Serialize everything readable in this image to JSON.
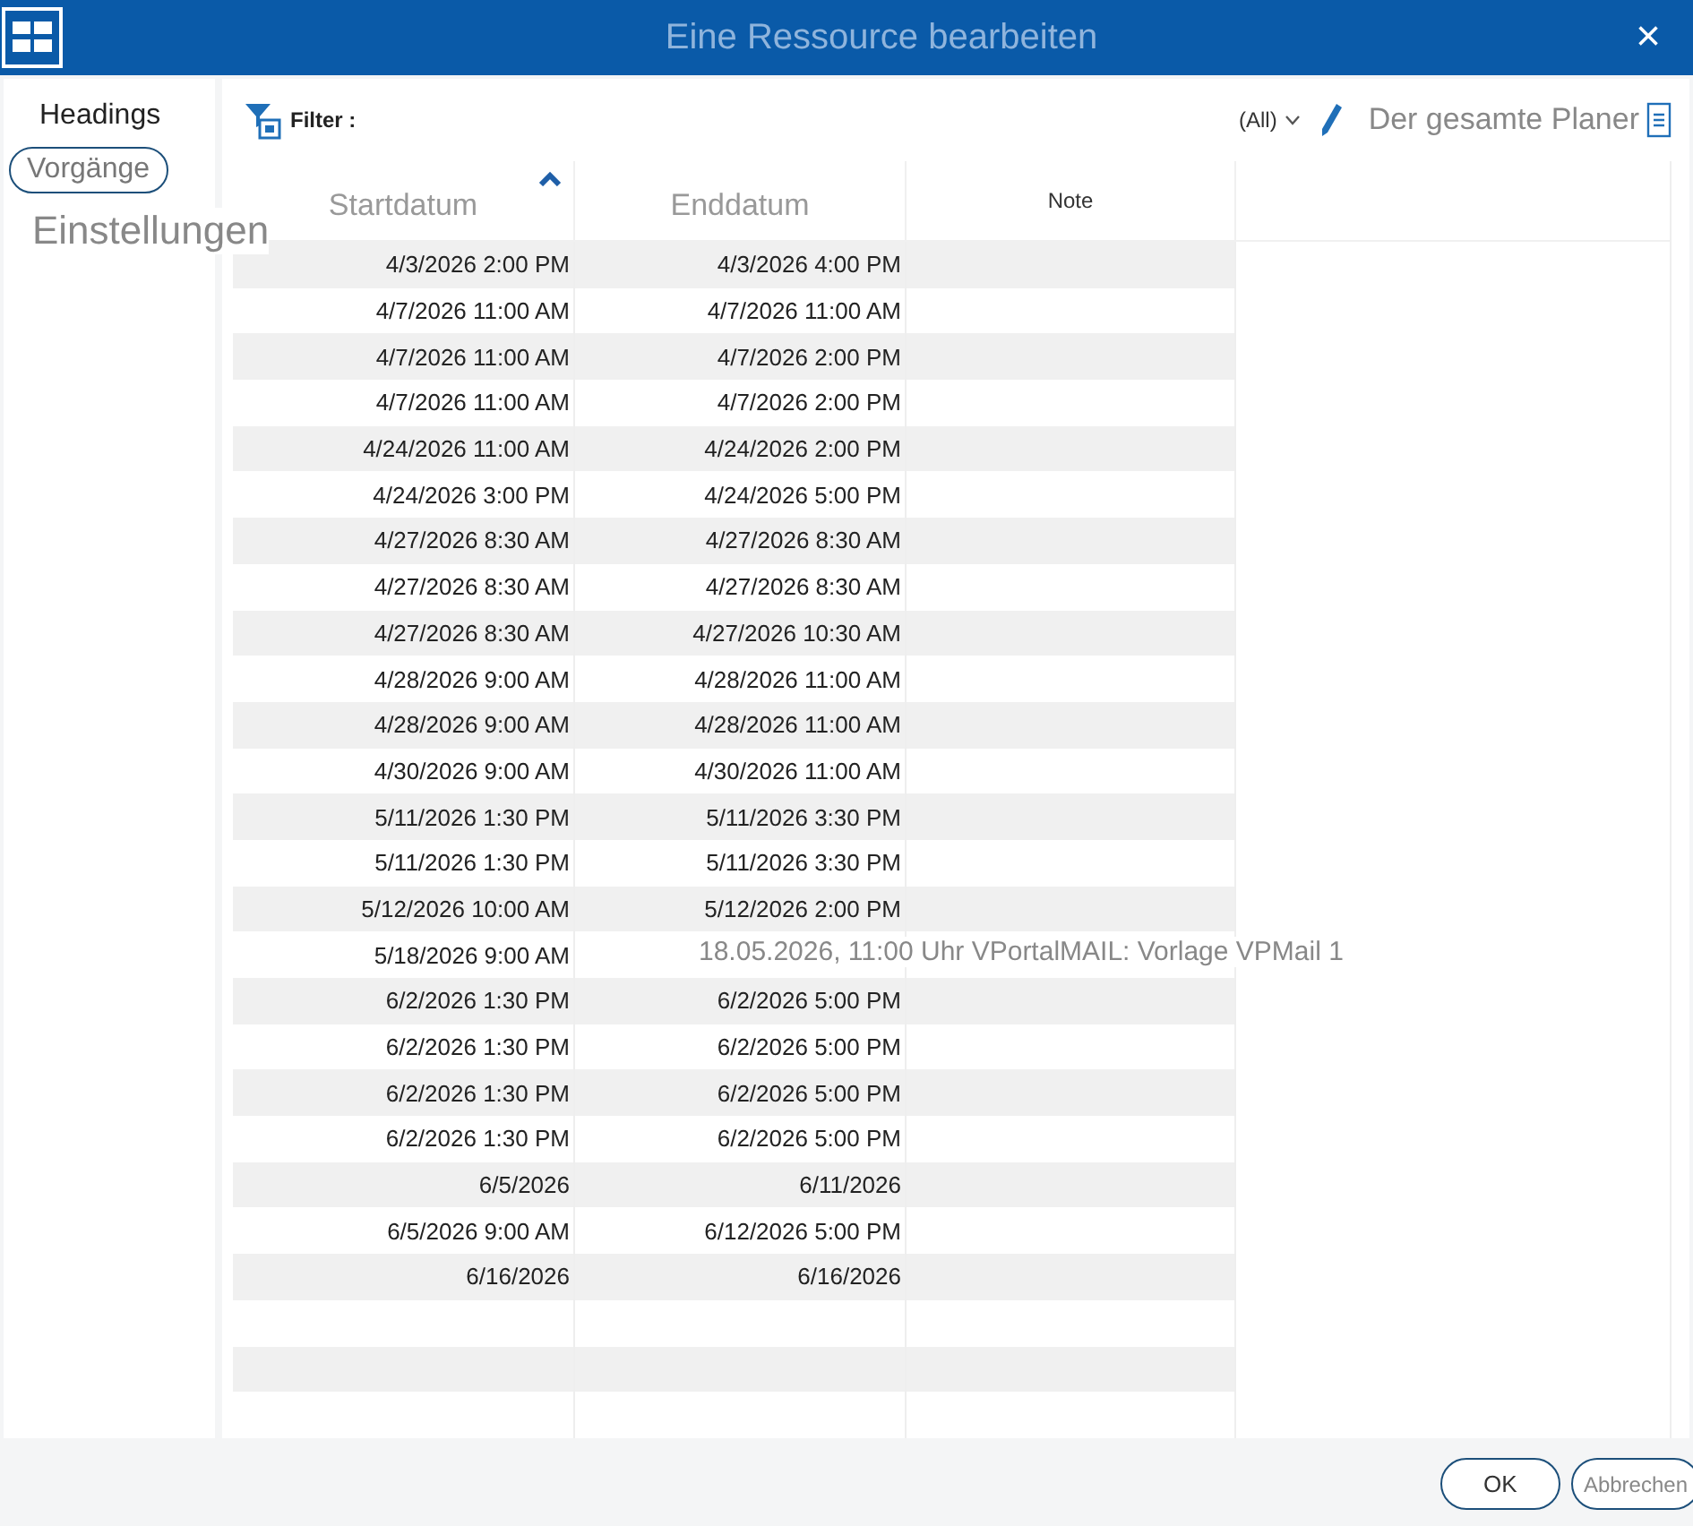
{
  "window": {
    "title": "Eine Ressource bearbeiten",
    "close": "×"
  },
  "sidebar": {
    "heading": "Headings",
    "items": [
      {
        "label": "Vorgänge",
        "selected": true
      },
      {
        "label": "Einstellungen",
        "selected": false
      }
    ]
  },
  "toolbar": {
    "filter_label": "Filter :",
    "scope": "(All)",
    "view": "Der gesamte Planer"
  },
  "table": {
    "columns": [
      {
        "label": "Startdatum",
        "sorted": true
      },
      {
        "label": "Enddatum",
        "sorted": false
      },
      {
        "label": "Note",
        "sorted": false
      }
    ],
    "rows": [
      {
        "start": "4/3/2026 2:00 PM",
        "end": "4/3/2026 4:00 PM"
      },
      {
        "start": "4/7/2026 11:00 AM",
        "end": "4/7/2026 11:00 AM"
      },
      {
        "start": "4/7/2026 11:00 AM",
        "end": "4/7/2026 2:00 PM"
      },
      {
        "start": "4/7/2026 11:00 AM",
        "end": "4/7/2026 2:00 PM"
      },
      {
        "start": "4/24/2026 11:00 AM",
        "end": "4/24/2026 2:00 PM"
      },
      {
        "start": "4/24/2026 3:00 PM",
        "end": "4/24/2026 5:00 PM"
      },
      {
        "start": "4/27/2026 8:30 AM",
        "end": "4/27/2026 8:30 AM"
      },
      {
        "start": "4/27/2026 8:30 AM",
        "end": "4/27/2026 8:30 AM"
      },
      {
        "start": "4/27/2026 8:30 AM",
        "end": "4/27/2026 10:30 AM"
      },
      {
        "start": "4/28/2026 9:00 AM",
        "end": "4/28/2026 11:00 AM"
      },
      {
        "start": "4/28/2026 9:00 AM",
        "end": "4/28/2026 11:00 AM"
      },
      {
        "start": "4/30/2026 9:00 AM",
        "end": "4/30/2026 11:00 AM"
      },
      {
        "start": "5/11/2026 1:30 PM",
        "end": "5/11/2026 3:30 PM"
      },
      {
        "start": "5/11/2026 1:30 PM",
        "end": "5/11/2026 3:30 PM"
      },
      {
        "start": "5/12/2026 10:00 AM",
        "end": "5/12/2026 2:00 PM"
      },
      {
        "start": "5/18/2026 9:00 AM",
        "tooltip": "18.05.2026, 11:00 Uhr VPortalMAIL: Vorlage VPMail 1"
      },
      {
        "start": "6/2/2026 1:30 PM",
        "end": "6/2/2026 5:00 PM"
      },
      {
        "start": "6/2/2026 1:30 PM",
        "end": "6/2/2026 5:00 PM"
      },
      {
        "start": "6/2/2026 1:30 PM",
        "end": "6/2/2026 5:00 PM"
      },
      {
        "start": "6/2/2026 1:30 PM",
        "end": "6/2/2026 5:00 PM"
      },
      {
        "start": "6/5/2026",
        "end": "6/11/2026"
      },
      {
        "start": "6/5/2026 9:00 AM",
        "end": "6/12/2026 5:00 PM"
      },
      {
        "start": "6/16/2026",
        "end": "6/16/2026"
      }
    ]
  },
  "buttons": [
    {
      "label": "OK",
      "kind": "primary"
    },
    {
      "label": "Abbrechen",
      "kind": "secondary"
    }
  ]
}
